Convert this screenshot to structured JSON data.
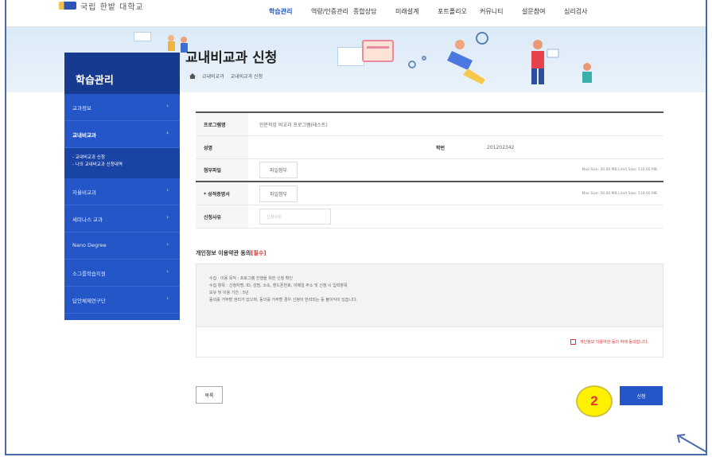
{
  "topbar": {
    "logo_text": "국립 한밭 대학교",
    "nav": [
      "학습관리",
      "역량/인증관리",
      "종합상담",
      "미래설계",
      "포트폴리오",
      "커뮤니티",
      "설문참여",
      "심리검사"
    ]
  },
  "banner": {
    "title": "교내비교과 신청",
    "breadcrumb": [
      "교내비교과",
      "교내비교과 신청"
    ]
  },
  "sidebar": {
    "heading": "학습관리",
    "items": [
      {
        "label": "교과정보"
      },
      {
        "label": "교내비교과"
      },
      {
        "label": "자율비교과"
      },
      {
        "label": "세미나스 교과"
      },
      {
        "label": "Nano Degree"
      },
      {
        "label": "소그룹학습지원"
      },
      {
        "label": "답안체제연구단"
      }
    ],
    "sub_items": [
      "- 교내비교과 신청",
      "- 나의 교내비교과 신청내역"
    ],
    "arrow": "›"
  },
  "form": {
    "program_label": "프로그램명",
    "program_value": "인문학강 비교과 프로그램(테스트)",
    "name_label": "성명",
    "name_value": "",
    "student_id_label": "학번",
    "student_id_value": "201202342",
    "attach_label": "첨부파일",
    "attach_btn": "파일첨부",
    "attach_note": "Max Size: 30.00 MB Limit Size: 130.00 MB",
    "cert_label": "* 성적증명서",
    "cert_btn": "파일첨부",
    "cert_note": "Max Size: 30.00 MB Limit Size: 130.00 MB",
    "reason_label": "신청사유",
    "reason_placeholder": "신청사유"
  },
  "agreement": {
    "title": "개인정보 이용약관 동의",
    "required": "[필수]",
    "lines": [
      "수집 · 이용 목적 : 프로그램 진행을 위한 신청 확인",
      "수집 항목 : 신청자명, ID, 성명, 소속, 핸드폰번호, 이메일 주소 및 신청 시 입력항목",
      "보유 및 이용 기간 : 5년",
      "동의를 거부할 권리가 있으며, 동의를 거부할 경우 신청이 반려되는 등 불이익이 있습니다."
    ],
    "check_label": "개인정보 이용약관 동의 하에 동의합니다."
  },
  "buttons": {
    "list": "목록",
    "apply": "신청"
  },
  "annotation": {
    "step": "2"
  }
}
